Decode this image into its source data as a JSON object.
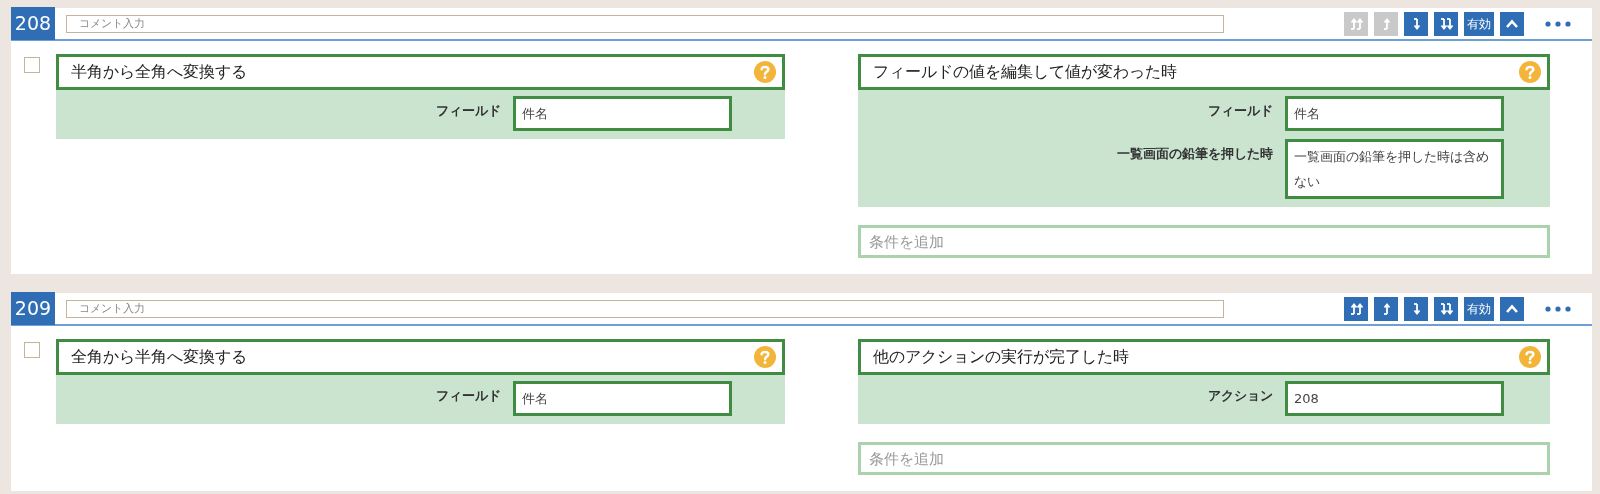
{
  "rules": [
    {
      "number": "208",
      "comment": {
        "placeholder": "コメント入力"
      },
      "checked": false,
      "tools": [
        {
          "kind": "top",
          "disabled": true
        },
        {
          "kind": "up",
          "disabled": true
        },
        {
          "kind": "down",
          "disabled": false
        },
        {
          "kind": "bottom",
          "disabled": false
        },
        {
          "kind": "toggle",
          "label": "有効",
          "disabled": false
        },
        {
          "kind": "collapse",
          "disabled": false
        },
        {
          "kind": "more",
          "disabled": false
        }
      ],
      "action": {
        "title": "半角から全角へ変換する",
        "params": [
          {
            "label": "フィールド",
            "value": "件名"
          }
        ]
      },
      "trigger": {
        "title": "フィールドの値を編集して値が変わった時",
        "params": [
          {
            "label": "フィールド",
            "value": "件名"
          },
          {
            "label": "一覧画面の鉛筆を押した時",
            "value": "一覧画面の鉛筆を押した時は含めない"
          }
        ]
      },
      "add_condition": {
        "placeholder": "条件を追加"
      }
    },
    {
      "number": "209",
      "comment": {
        "placeholder": "コメント入力"
      },
      "checked": false,
      "tools": [
        {
          "kind": "top",
          "disabled": false
        },
        {
          "kind": "up",
          "disabled": false
        },
        {
          "kind": "down",
          "disabled": false
        },
        {
          "kind": "bottom",
          "disabled": false
        },
        {
          "kind": "toggle",
          "label": "有効",
          "disabled": false
        },
        {
          "kind": "collapse",
          "disabled": false
        },
        {
          "kind": "more",
          "disabled": false
        }
      ],
      "action": {
        "title": "全角から半角へ変換する",
        "params": [
          {
            "label": "フィールド",
            "value": "件名"
          }
        ]
      },
      "trigger": {
        "title": "他のアクションの実行が完了した時",
        "params": [
          {
            "label": "アクション",
            "value": "208"
          }
        ]
      },
      "add_condition": {
        "placeholder": "条件を追加"
      }
    }
  ]
}
